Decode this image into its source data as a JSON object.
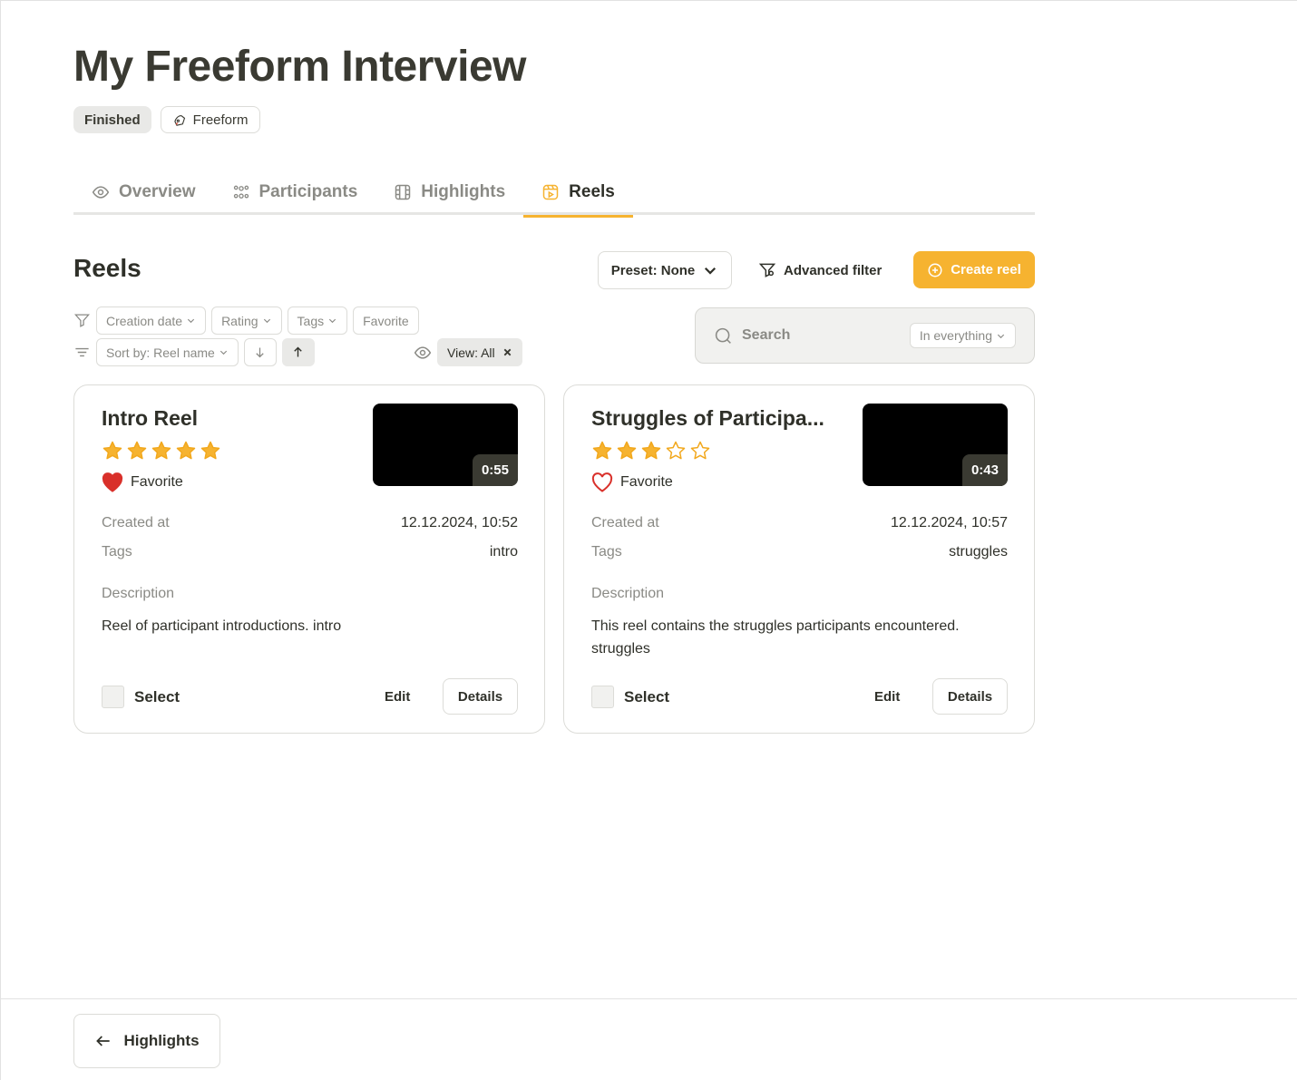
{
  "page": {
    "title": "My Freeform Interview",
    "status_badge": "Finished",
    "type_badge": "Freeform"
  },
  "tabs": [
    {
      "label": "Overview",
      "icon": "eye-icon",
      "active": false
    },
    {
      "label": "Participants",
      "icon": "participants-icon",
      "active": false
    },
    {
      "label": "Highlights",
      "icon": "film-icon",
      "active": false
    },
    {
      "label": "Reels",
      "icon": "reel-icon",
      "active": true
    }
  ],
  "toolbar": {
    "section_title": "Reels",
    "preset_label": "Preset: None",
    "advanced_filter_label": "Advanced filter",
    "create_label": "Create reel",
    "accent_color": "#f6b330"
  },
  "filters": {
    "chips": [
      "Creation date",
      "Rating",
      "Tags",
      "Favorite"
    ],
    "sort_label": "Sort by: Reel name",
    "view_label": "View: All"
  },
  "search": {
    "placeholder": "Search",
    "scope": "In everything"
  },
  "reels": [
    {
      "title": "Intro Reel",
      "rating": 5,
      "favorite": true,
      "favorite_label": "Favorite",
      "duration": "0:55",
      "created_label": "Created at",
      "created_at": "12.12.2024, 10:52",
      "tags_label": "Tags",
      "tags": "intro",
      "description_label": "Description",
      "description": "Reel of participant introductions. intro",
      "select_label": "Select",
      "edit_label": "Edit",
      "details_label": "Details"
    },
    {
      "title": "Struggles of Participa...",
      "rating": 3,
      "favorite": false,
      "favorite_label": "Favorite",
      "duration": "0:43",
      "created_label": "Created at",
      "created_at": "12.12.2024, 10:57",
      "tags_label": "Tags",
      "tags": "struggles",
      "description_label": "Description",
      "description": "This reel contains the struggles participants encountered. struggles",
      "select_label": "Select",
      "edit_label": "Edit",
      "details_label": "Details"
    }
  ],
  "footer": {
    "back_label": "Highlights"
  }
}
